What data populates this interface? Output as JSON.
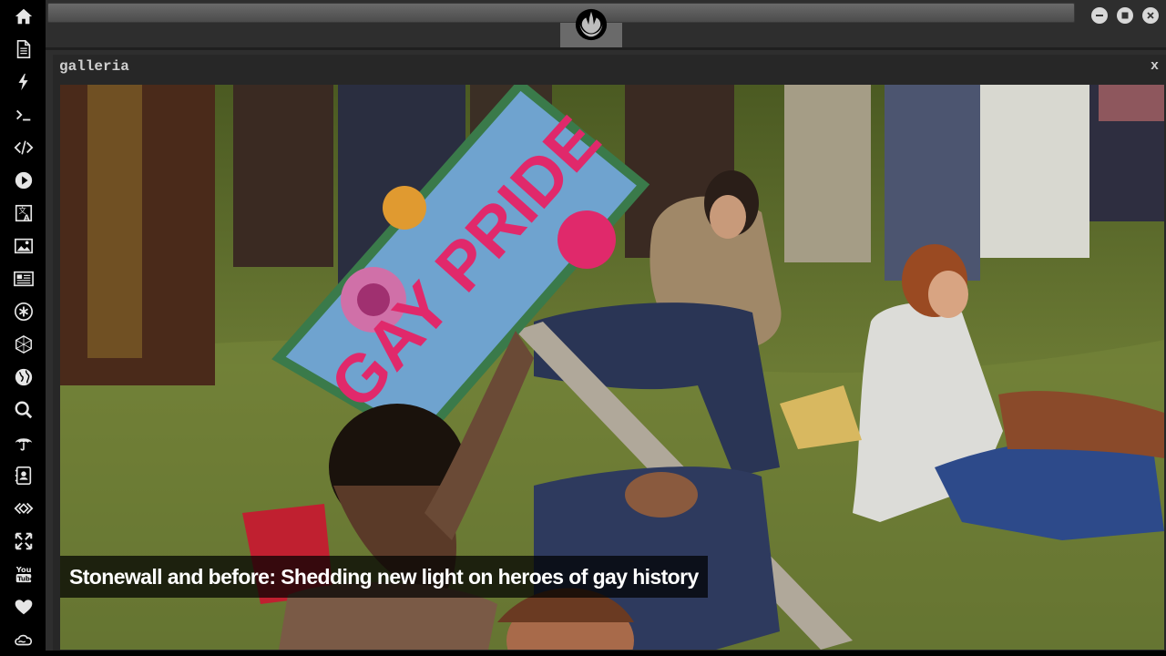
{
  "window": {
    "title": "galleria",
    "close_label": "x"
  },
  "gallery": {
    "caption": "Stonewall and before: Shedding new light on heroes of gay history",
    "sign_text": "GAY PRIDE"
  },
  "sidebar": {
    "items": [
      {
        "icon": "home-icon"
      },
      {
        "icon": "document-icon"
      },
      {
        "icon": "lightning-icon"
      },
      {
        "icon": "terminal-icon"
      },
      {
        "icon": "code-icon"
      },
      {
        "icon": "play-icon"
      },
      {
        "icon": "translate-icon"
      },
      {
        "icon": "image-icon"
      },
      {
        "icon": "newspaper-icon"
      },
      {
        "icon": "asterisk-icon"
      },
      {
        "icon": "hexagon-icon"
      },
      {
        "icon": "globe-icon"
      },
      {
        "icon": "search-icon"
      },
      {
        "icon": "umbrella-icon"
      },
      {
        "icon": "contact-book-icon"
      },
      {
        "icon": "nodes-icon"
      },
      {
        "icon": "fullscreen-icon"
      },
      {
        "icon": "youtube-icon"
      },
      {
        "icon": "heart-icon"
      },
      {
        "icon": "cloud-icon"
      }
    ]
  },
  "controls": {
    "minimize": "minimize-icon",
    "maximize": "maximize-icon",
    "close": "close-icon"
  },
  "colors": {
    "sidebar_bg": "#000000",
    "chrome_bg": "#2e2e2e",
    "sign_blue": "#6fa3cf",
    "sign_pink": "#e0296b"
  }
}
